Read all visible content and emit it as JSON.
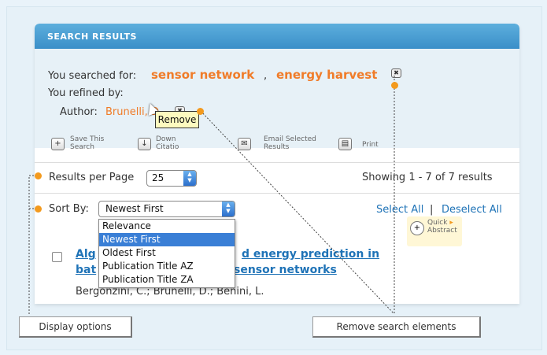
{
  "panel": {
    "title": "SEARCH RESULTS"
  },
  "query": {
    "searched_label": "You searched for:",
    "terms": [
      "sensor network",
      "energy harvest"
    ],
    "separator": ",",
    "refined_label": "You refined by:",
    "author_label": "Author:",
    "author_value": "Brunelli, D."
  },
  "remove_icon_glyph": "✖",
  "tooltip": "Remove",
  "toolbar": {
    "save": [
      "Save This",
      "Search"
    ],
    "download": [
      "Down",
      "Citatio"
    ],
    "email": [
      "Email Selected",
      "Results"
    ],
    "print": "Print"
  },
  "results_per_page": {
    "label": "Results per Page",
    "value": "25"
  },
  "showing": "Showing 1 - 7 of 7 results",
  "sort": {
    "label": "Sort By:",
    "value": "Newest First",
    "options": [
      "Relevance",
      "Newest First",
      "Oldest First",
      "Publication Title AZ",
      "Publication Title ZA"
    ],
    "selected_index": 1
  },
  "selection": {
    "select_all": "Select All",
    "separator": "|",
    "deselect_all": "Deselect All"
  },
  "result": {
    "title_line1_start": "Alg",
    "title_line1_end": "d energy prediction in",
    "title_line2_start": "bat",
    "title_line2_end": "sensor networks",
    "authors": "Bergonzini, C.; Brunelli, D.; Benini, L."
  },
  "quick_abstract": [
    "Quick",
    "Abstract"
  ],
  "callouts": {
    "display_options": "Display options",
    "remove_elements": "Remove search elements"
  },
  "colors": {
    "accent_orange": "#f07c29",
    "link_blue": "#1f73b7",
    "header_blue": "#3a8fc8",
    "dot_orange": "#f39a1e"
  }
}
